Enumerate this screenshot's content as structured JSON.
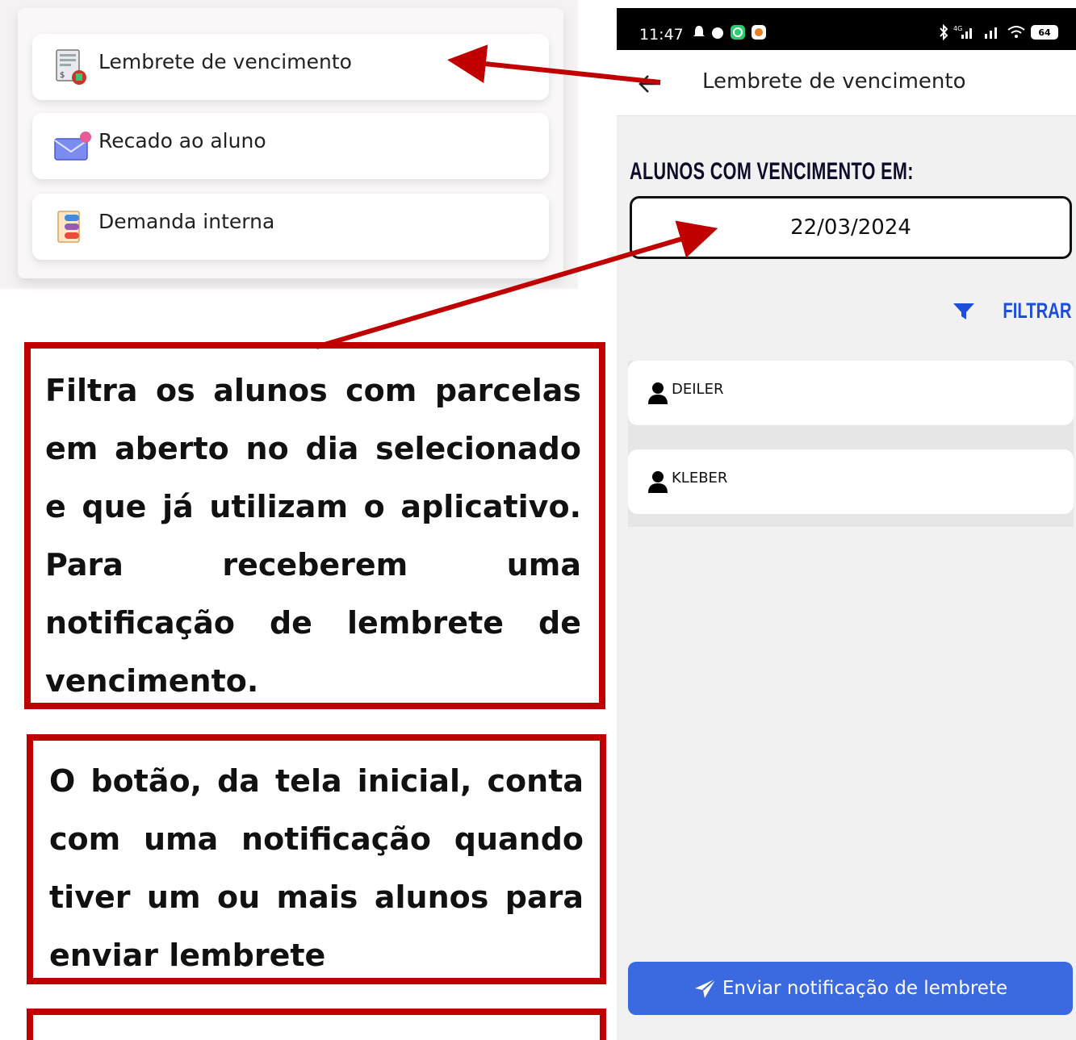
{
  "menu": {
    "items": [
      {
        "label": "Lembrete de vencimento",
        "icon": "invoice-icon"
      },
      {
        "label": "Recado ao aluno",
        "icon": "envelope-icon"
      },
      {
        "label": "Demanda interna",
        "icon": "task-list-icon"
      }
    ]
  },
  "status_bar": {
    "time": "11:47",
    "battery": "64"
  },
  "app_bar": {
    "title": "Lembrete de vencimento",
    "back_icon": "arrow-back-icon"
  },
  "form": {
    "heading": "ALUNOS COM VENCIMENTO EM:",
    "date_value": "22/03/2024",
    "filter_label": "FILTRAR",
    "filter_icon": "funnel-icon"
  },
  "students": [
    {
      "name": "DEILER"
    },
    {
      "name": "KLEBER"
    }
  ],
  "send_button": {
    "label": "Enviar notificação de lembrete",
    "icon": "send-icon"
  },
  "annotations": {
    "note1": [
      "Filtra os alunos com parcelas",
      "em aberto no dia selecionado",
      "e que já utilizam o aplicativo.",
      "Para receberem uma",
      "notificação de lembrete de",
      "vencimento."
    ],
    "note2": [
      "O botão, da tela inicial, conta",
      "com uma notificação quando",
      "tiver um ou mais alunos para",
      "enviar lembrete"
    ]
  },
  "colors": {
    "annotation_red": "#c00000",
    "primary_blue": "#3b69e0",
    "filter_blue": "#1d4ed8"
  }
}
